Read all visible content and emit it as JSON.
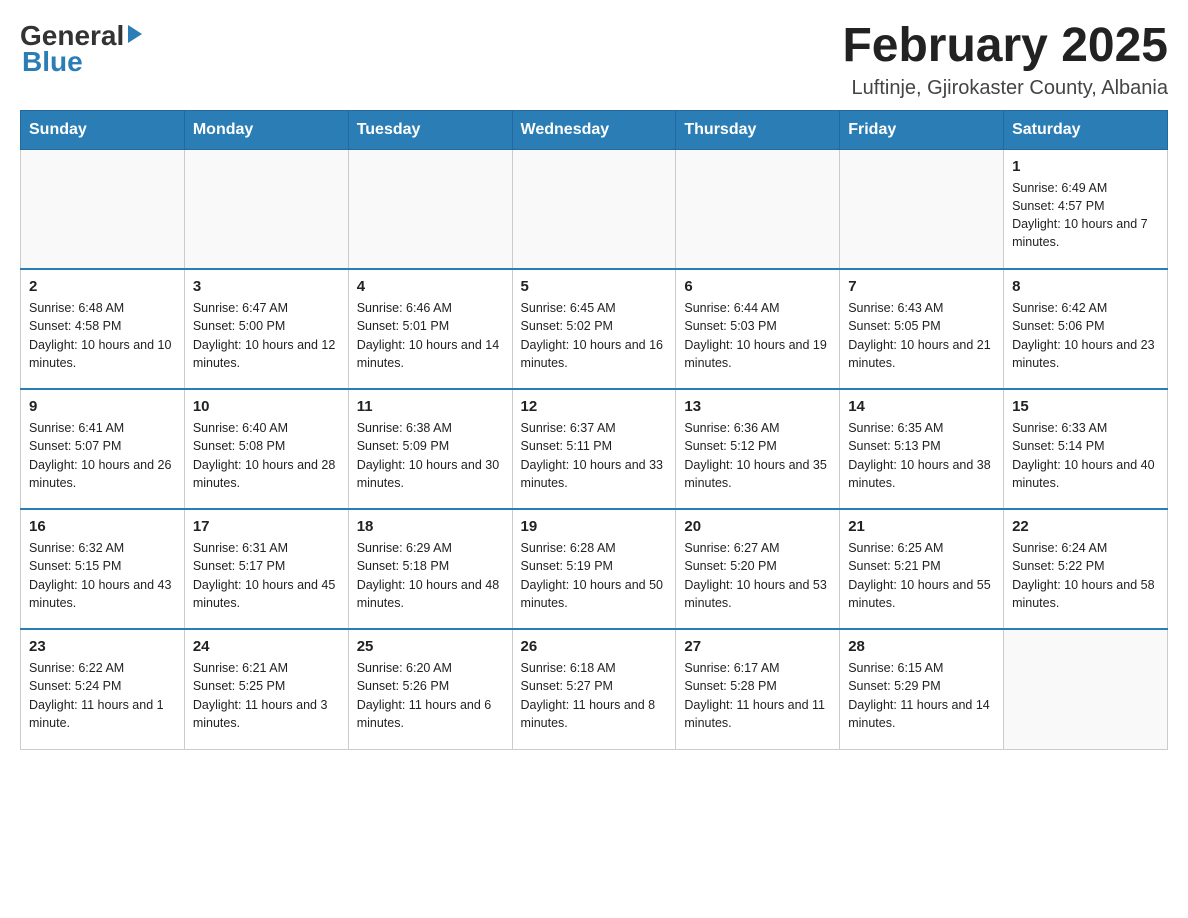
{
  "header": {
    "logo_general": "General",
    "logo_blue": "Blue",
    "title": "February 2025",
    "subtitle": "Luftinje, Gjirokaster County, Albania"
  },
  "days_of_week": [
    "Sunday",
    "Monday",
    "Tuesday",
    "Wednesday",
    "Thursday",
    "Friday",
    "Saturday"
  ],
  "weeks": [
    [
      {
        "day": "",
        "info": ""
      },
      {
        "day": "",
        "info": ""
      },
      {
        "day": "",
        "info": ""
      },
      {
        "day": "",
        "info": ""
      },
      {
        "day": "",
        "info": ""
      },
      {
        "day": "",
        "info": ""
      },
      {
        "day": "1",
        "info": "Sunrise: 6:49 AM\nSunset: 4:57 PM\nDaylight: 10 hours and 7 minutes."
      }
    ],
    [
      {
        "day": "2",
        "info": "Sunrise: 6:48 AM\nSunset: 4:58 PM\nDaylight: 10 hours and 10 minutes."
      },
      {
        "day": "3",
        "info": "Sunrise: 6:47 AM\nSunset: 5:00 PM\nDaylight: 10 hours and 12 minutes."
      },
      {
        "day": "4",
        "info": "Sunrise: 6:46 AM\nSunset: 5:01 PM\nDaylight: 10 hours and 14 minutes."
      },
      {
        "day": "5",
        "info": "Sunrise: 6:45 AM\nSunset: 5:02 PM\nDaylight: 10 hours and 16 minutes."
      },
      {
        "day": "6",
        "info": "Sunrise: 6:44 AM\nSunset: 5:03 PM\nDaylight: 10 hours and 19 minutes."
      },
      {
        "day": "7",
        "info": "Sunrise: 6:43 AM\nSunset: 5:05 PM\nDaylight: 10 hours and 21 minutes."
      },
      {
        "day": "8",
        "info": "Sunrise: 6:42 AM\nSunset: 5:06 PM\nDaylight: 10 hours and 23 minutes."
      }
    ],
    [
      {
        "day": "9",
        "info": "Sunrise: 6:41 AM\nSunset: 5:07 PM\nDaylight: 10 hours and 26 minutes."
      },
      {
        "day": "10",
        "info": "Sunrise: 6:40 AM\nSunset: 5:08 PM\nDaylight: 10 hours and 28 minutes."
      },
      {
        "day": "11",
        "info": "Sunrise: 6:38 AM\nSunset: 5:09 PM\nDaylight: 10 hours and 30 minutes."
      },
      {
        "day": "12",
        "info": "Sunrise: 6:37 AM\nSunset: 5:11 PM\nDaylight: 10 hours and 33 minutes."
      },
      {
        "day": "13",
        "info": "Sunrise: 6:36 AM\nSunset: 5:12 PM\nDaylight: 10 hours and 35 minutes."
      },
      {
        "day": "14",
        "info": "Sunrise: 6:35 AM\nSunset: 5:13 PM\nDaylight: 10 hours and 38 minutes."
      },
      {
        "day": "15",
        "info": "Sunrise: 6:33 AM\nSunset: 5:14 PM\nDaylight: 10 hours and 40 minutes."
      }
    ],
    [
      {
        "day": "16",
        "info": "Sunrise: 6:32 AM\nSunset: 5:15 PM\nDaylight: 10 hours and 43 minutes."
      },
      {
        "day": "17",
        "info": "Sunrise: 6:31 AM\nSunset: 5:17 PM\nDaylight: 10 hours and 45 minutes."
      },
      {
        "day": "18",
        "info": "Sunrise: 6:29 AM\nSunset: 5:18 PM\nDaylight: 10 hours and 48 minutes."
      },
      {
        "day": "19",
        "info": "Sunrise: 6:28 AM\nSunset: 5:19 PM\nDaylight: 10 hours and 50 minutes."
      },
      {
        "day": "20",
        "info": "Sunrise: 6:27 AM\nSunset: 5:20 PM\nDaylight: 10 hours and 53 minutes."
      },
      {
        "day": "21",
        "info": "Sunrise: 6:25 AM\nSunset: 5:21 PM\nDaylight: 10 hours and 55 minutes."
      },
      {
        "day": "22",
        "info": "Sunrise: 6:24 AM\nSunset: 5:22 PM\nDaylight: 10 hours and 58 minutes."
      }
    ],
    [
      {
        "day": "23",
        "info": "Sunrise: 6:22 AM\nSunset: 5:24 PM\nDaylight: 11 hours and 1 minute."
      },
      {
        "day": "24",
        "info": "Sunrise: 6:21 AM\nSunset: 5:25 PM\nDaylight: 11 hours and 3 minutes."
      },
      {
        "day": "25",
        "info": "Sunrise: 6:20 AM\nSunset: 5:26 PM\nDaylight: 11 hours and 6 minutes."
      },
      {
        "day": "26",
        "info": "Sunrise: 6:18 AM\nSunset: 5:27 PM\nDaylight: 11 hours and 8 minutes."
      },
      {
        "day": "27",
        "info": "Sunrise: 6:17 AM\nSunset: 5:28 PM\nDaylight: 11 hours and 11 minutes."
      },
      {
        "day": "28",
        "info": "Sunrise: 6:15 AM\nSunset: 5:29 PM\nDaylight: 11 hours and 14 minutes."
      },
      {
        "day": "",
        "info": ""
      }
    ]
  ]
}
